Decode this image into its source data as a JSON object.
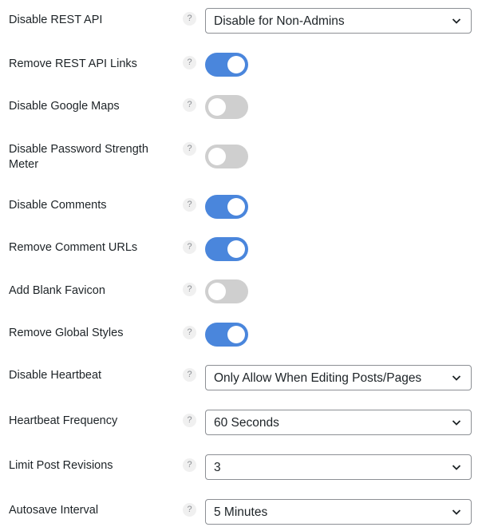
{
  "settings": [
    {
      "label": "Disable REST API",
      "help": "?",
      "type": "select",
      "value": "Disable for Non-Admins",
      "icon": "chevron-down-icon"
    },
    {
      "label": "Remove REST API Links",
      "help": "?",
      "type": "toggle",
      "on": true
    },
    {
      "label": "Disable Google Maps",
      "help": "?",
      "type": "toggle",
      "on": false
    },
    {
      "label": "Disable Password Strength Meter",
      "help": "?",
      "type": "toggle",
      "on": false
    },
    {
      "label": "Disable Comments",
      "help": "?",
      "type": "toggle",
      "on": true
    },
    {
      "label": "Remove Comment URLs",
      "help": "?",
      "type": "toggle",
      "on": true
    },
    {
      "label": "Add Blank Favicon",
      "help": "?",
      "type": "toggle",
      "on": false
    },
    {
      "label": "Remove Global Styles",
      "help": "?",
      "type": "toggle",
      "on": true
    },
    {
      "label": "Disable Heartbeat",
      "help": "?",
      "type": "select",
      "value": "Only Allow When Editing Posts/Pages",
      "icon": "chevron-down-icon"
    },
    {
      "label": "Heartbeat Frequency",
      "help": "?",
      "type": "select",
      "value": "60 Seconds",
      "icon": "chevron-down-icon"
    },
    {
      "label": "Limit Post Revisions",
      "help": "?",
      "type": "select",
      "value": "3",
      "icon": "chevron-down-icon"
    },
    {
      "label": "Autosave Interval",
      "help": "?",
      "type": "select",
      "value": "5 Minutes",
      "icon": "chevron-down-icon"
    }
  ],
  "colors": {
    "toggle_on": "#4a86dc",
    "toggle_off": "#cfcfcf"
  }
}
